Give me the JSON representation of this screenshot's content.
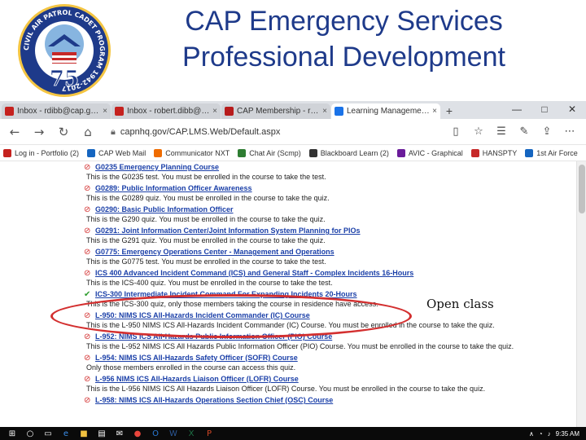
{
  "slide": {
    "title_line1": "CAP Emergency Services",
    "title_line2": "Professional Development",
    "title_color": "#1e3a8a",
    "seal": {
      "ring_text": "CIVIL AIR PATROL CADET PROGRAM 1942-2017",
      "anniversary": "75"
    }
  },
  "browser": {
    "tabs": [
      {
        "label": "Inbox - rdibb@cap.gov - Ci",
        "icon": "gmail-icon",
        "active": false
      },
      {
        "label": "Inbox - robert.dibb@wvwg",
        "icon": "gmail-icon",
        "active": false
      },
      {
        "label": "CAP Membership - robert.d",
        "icon": "cap-icon",
        "active": false
      },
      {
        "label": "Learning Management S",
        "icon": "lms-icon",
        "active": true
      }
    ],
    "new_tab_glyph": "+",
    "window_controls": [
      "—",
      "□",
      "✕"
    ],
    "address": "capnhq.gov/CAP.LMS.Web/Default.aspx",
    "bookmarks": [
      {
        "label": "Log in - Portfolio (2)",
        "color": "#c5221f"
      },
      {
        "label": "CAP Web Mail",
        "color": "#1565c0"
      },
      {
        "label": "Communicator NXT",
        "color": "#ef6c00"
      },
      {
        "label": "Chat Air (Scmp)",
        "color": "#2e7d32"
      },
      {
        "label": "Blackboard Learn (2)",
        "color": "#333333"
      },
      {
        "label": "AVIC - Graphical",
        "color": "#6a1b9a"
      },
      {
        "label": "HANSPTY",
        "color": "#c62828"
      },
      {
        "label": "1st Air Force",
        "color": "#1565c0"
      }
    ],
    "courses": [
      {
        "code_title": "G0235 Emergency Planning Course",
        "desc": "This is the G0235 test. You must be enrolled in the course to take the test.",
        "status": "no"
      },
      {
        "code_title": "G0289: Public Information Officer Awareness",
        "desc": "This is the G0289 quiz. You must be enrolled in the course to take the quiz.",
        "status": "no"
      },
      {
        "code_title": "G0290: Basic Public Information Officer",
        "desc": "This is the G290 quiz. You must be enrolled in the course to take the quiz.",
        "status": "no"
      },
      {
        "code_title": "G0291: Joint Information Center/Joint Information System Planning for PIOs",
        "desc": "This is the G291 quiz. You must be enrolled in the course to take the quiz.",
        "status": "no"
      },
      {
        "code_title": "G0775: Emergency Operations Center - Management and Operations",
        "desc": "This is the G0775 test. You must be enrolled in the course to take the test.",
        "status": "no"
      },
      {
        "code_title": "ICS 400 Advanced Incident Command (ICS) and General Staff - Complex Incidents 16-Hours",
        "desc": "This is the ICS-400 quiz. You must be enrolled in the course to take the test.",
        "status": "no"
      },
      {
        "code_title": "ICS-300 Intermediate Incident Command For Expanding Incidents 20-Hours",
        "desc": "This is the ICS-300 quiz, only those members taking the course in residence have access.",
        "status": "ok"
      },
      {
        "code_title": "L-950: NIMS ICS All-Hazards Incident Commander (IC) Course",
        "desc": "This is the L-950 NIMS ICS All-Hazards Incident Commander (IC) Course. You must be enrolled in the course to take the quiz.",
        "status": "no"
      },
      {
        "code_title": "L-952: NIMS ICS All-Hazards Public Information Officer (PIO) Course",
        "desc": "This is the L-952 NIMS ICS All Hazards Public Information Officer (PIO) Course. You must be enrolled in the course to take the quiz.",
        "status": "no"
      },
      {
        "code_title": "L-954: NIMS ICS All-Hazards Safety Officer (SOFR) Course",
        "desc": "Only those members enrolled in the course can access this quiz.",
        "status": "no"
      },
      {
        "code_title": "L-956 NIMS ICS All-Hazards Liaison Officer (LOFR) Course",
        "desc": "This is the L-956 NIMS ICS All Hazards Liaison Officer (LOFR) Course. You must be enrolled in the course to take the quiz.",
        "status": "no"
      },
      {
        "code_title": "L-958: NIMS ICS All-Hazards Operations Section Chief (OSC) Course",
        "desc": "",
        "status": "no"
      }
    ],
    "annotation": "Open class",
    "annotation_color": "#d32f2f",
    "taskbar": {
      "clock": "9:35 AM"
    }
  }
}
